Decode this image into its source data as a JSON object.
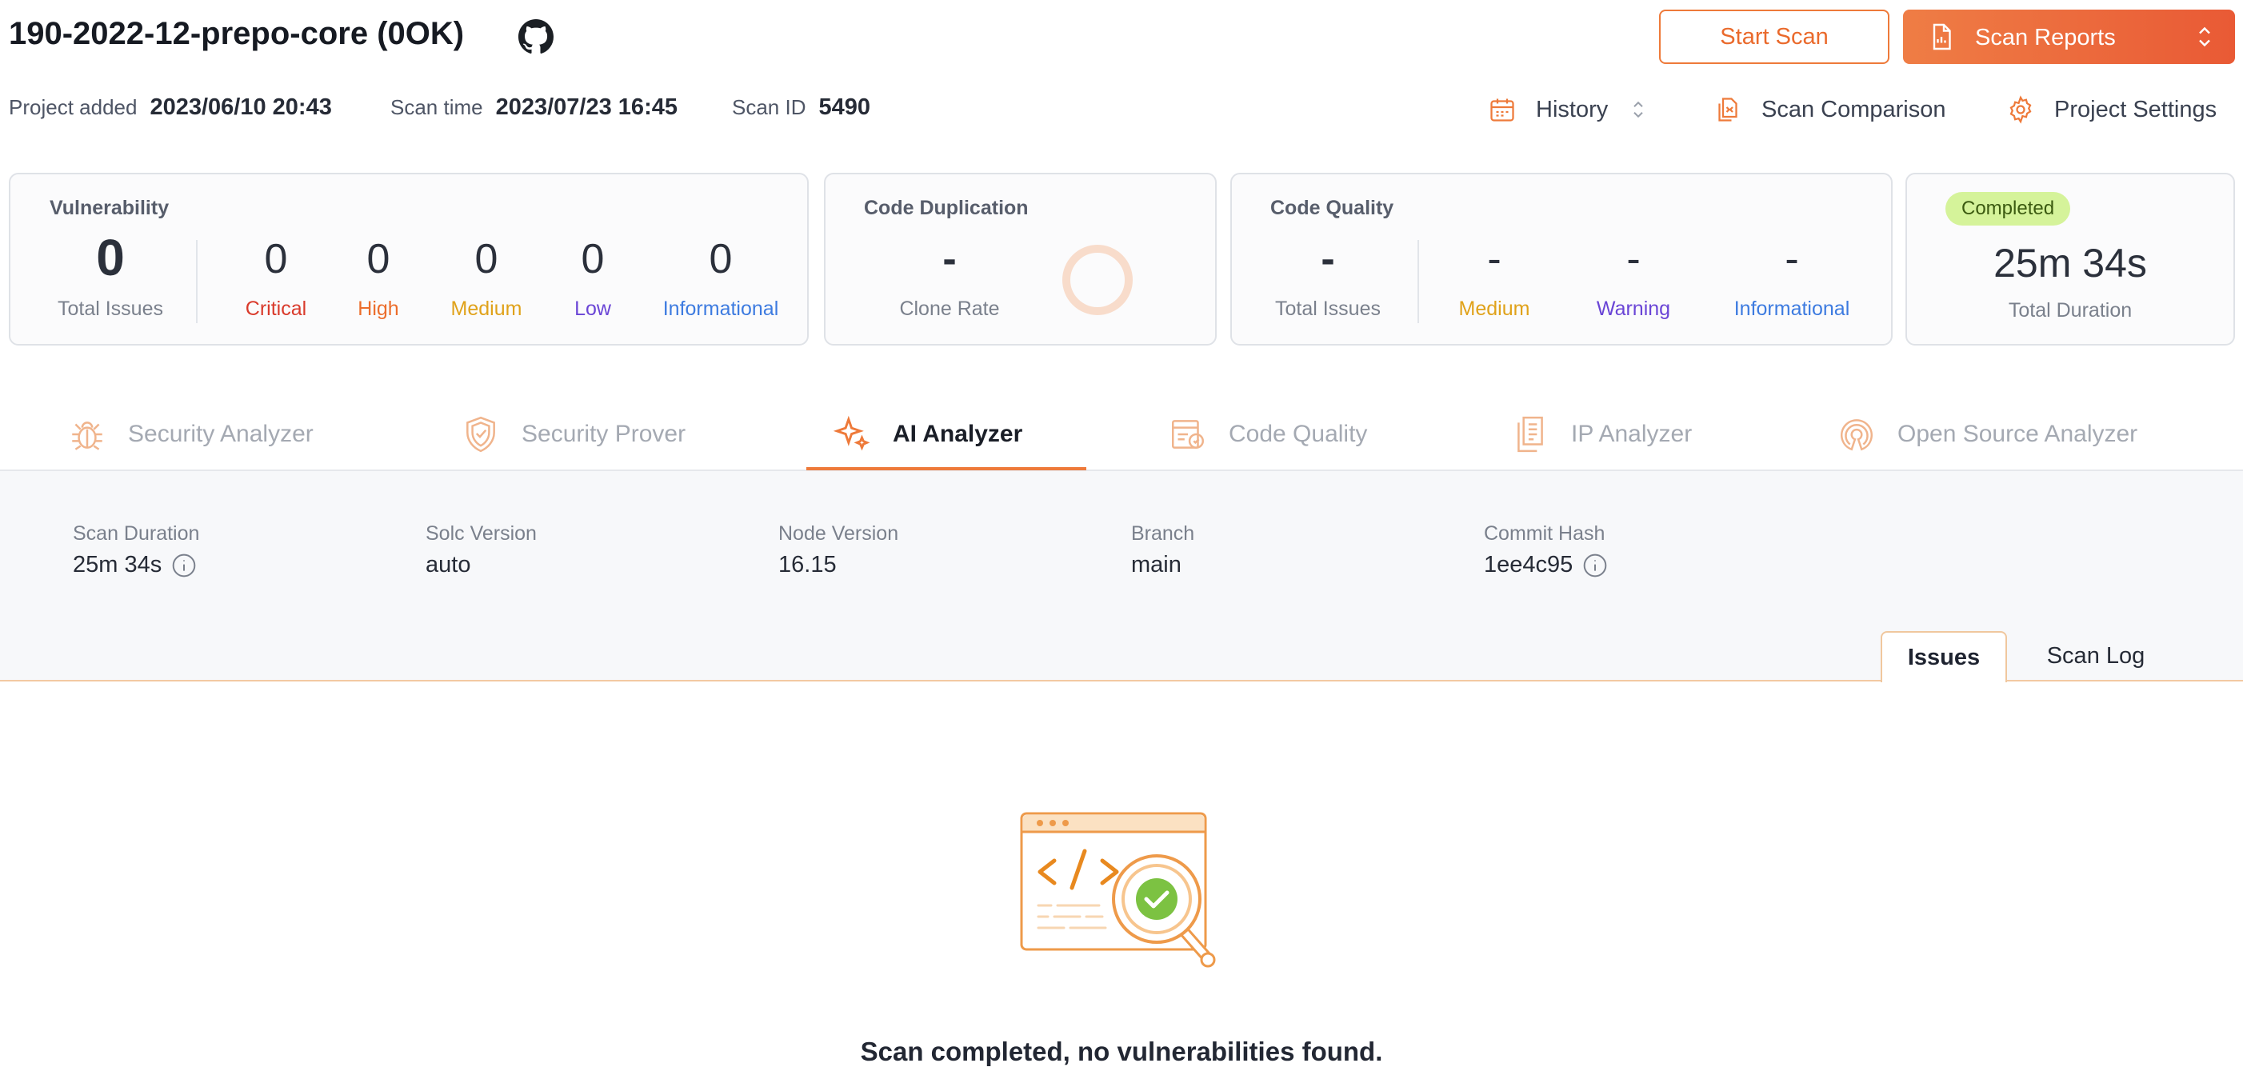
{
  "header": {
    "project_title": "190-2022-12-prepo-core (0OK)",
    "start_scan_label": "Start Scan",
    "scan_reports_label": "Scan Reports"
  },
  "meta": {
    "project_added_label": "Project added",
    "project_added_value": "2023/06/10 20:43",
    "scan_time_label": "Scan time",
    "scan_time_value": "2023/07/23 16:45",
    "scan_id_label": "Scan ID",
    "scan_id_value": "5490"
  },
  "toolbar": {
    "history_label": "History",
    "comparison_label": "Scan Comparison",
    "settings_label": "Project Settings"
  },
  "vulnerability": {
    "title": "Vulnerability",
    "total": "0",
    "total_label": "Total Issues",
    "levels": [
      {
        "value": "0",
        "label": "Critical",
        "color": "#d93a2b"
      },
      {
        "value": "0",
        "label": "High",
        "color": "#ec6d2b"
      },
      {
        "value": "0",
        "label": "Medium",
        "color": "#e0a21a"
      },
      {
        "value": "0",
        "label": "Low",
        "color": "#6a45d6"
      },
      {
        "value": "0",
        "label": "Informational",
        "color": "#3d7be0"
      }
    ]
  },
  "code_duplication": {
    "title": "Code Duplication",
    "value": "-",
    "label": "Clone Rate"
  },
  "code_quality": {
    "title": "Code Quality",
    "total": "-",
    "total_label": "Total Issues",
    "levels": [
      {
        "value": "-",
        "label": "Medium",
        "color": "#e0a21a"
      },
      {
        "value": "-",
        "label": "Warning",
        "color": "#6a45d6"
      },
      {
        "value": "-",
        "label": "Informational",
        "color": "#3d7be0"
      }
    ]
  },
  "status": {
    "badge": "Completed",
    "duration": "25m 34s",
    "duration_label": "Total Duration"
  },
  "tabs": [
    {
      "label": "Security Analyzer",
      "icon": "bug-icon"
    },
    {
      "label": "Security Prover",
      "icon": "shield-icon"
    },
    {
      "label": "AI Analyzer",
      "icon": "sparkle-icon",
      "active": true
    },
    {
      "label": "Code Quality",
      "icon": "code-quality-icon"
    },
    {
      "label": "IP Analyzer",
      "icon": "document-stack-icon"
    },
    {
      "label": "Open Source Analyzer",
      "icon": "open-source-icon"
    }
  ],
  "details": {
    "scan_duration_label": "Scan Duration",
    "scan_duration_value": "25m 34s",
    "solc_label": "Solc Version",
    "solc_value": "auto",
    "node_label": "Node Version",
    "node_value": "16.15",
    "branch_label": "Branch",
    "branch_value": "main",
    "commit_label": "Commit Hash",
    "commit_value": "1ee4c95"
  },
  "subtabs": {
    "issues": "Issues",
    "scan_log": "Scan Log"
  },
  "empty_state": {
    "message": "Scan completed, no vulnerabilities found."
  }
}
